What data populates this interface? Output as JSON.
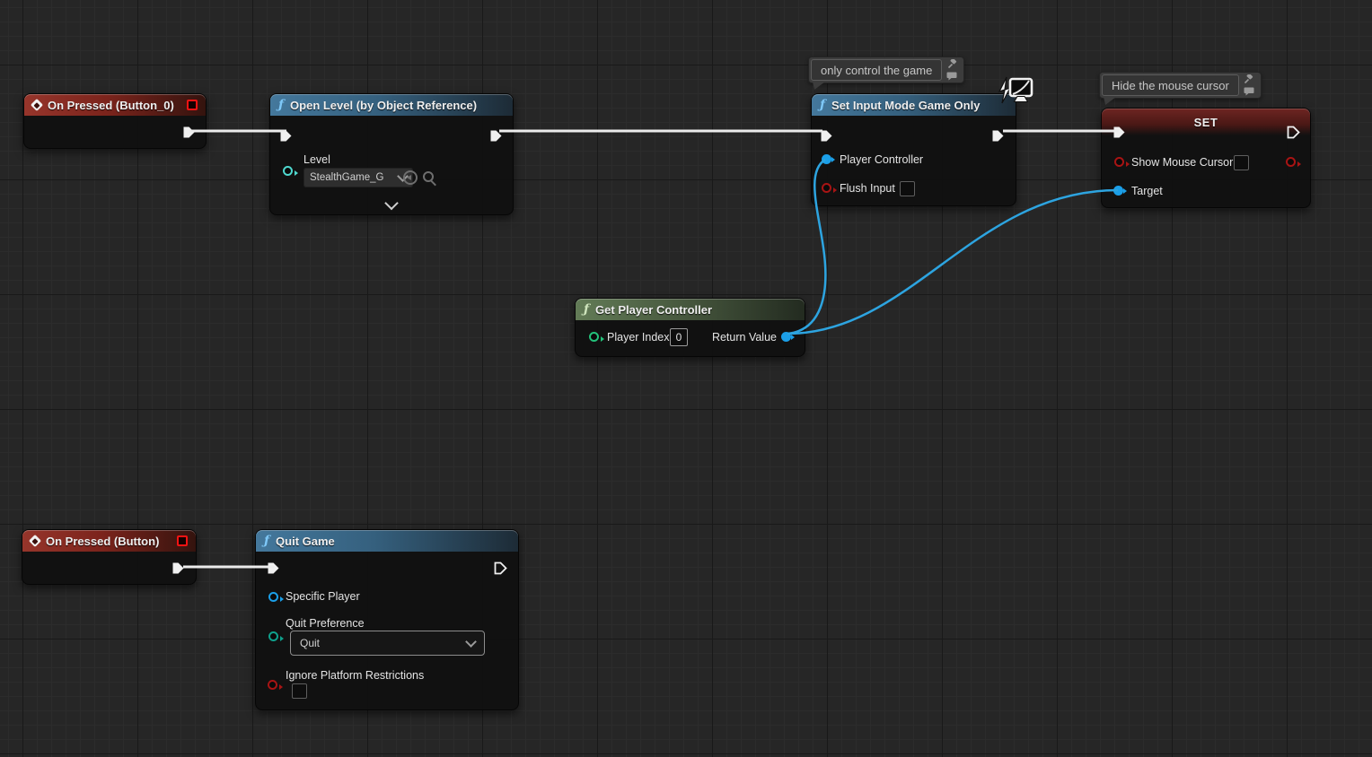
{
  "graph": {
    "comments": {
      "game_only": "only control the game",
      "hide_cursor": "Hide the mouse cursor"
    },
    "nodes": {
      "on_pressed_0": {
        "title": "On Pressed (Button_0)"
      },
      "open_level": {
        "title": "Open Level (by Object Reference)",
        "level_label": "Level",
        "level_value": "StealthGame_G"
      },
      "set_input_mode": {
        "title": "Set Input Mode Game Only",
        "player_controller_label": "Player Controller",
        "flush_input_label": "Flush Input"
      },
      "set_show_mouse": {
        "title": "SET",
        "show_mouse_cursor_label": "Show Mouse Cursor",
        "target_label": "Target"
      },
      "get_player_controller": {
        "title": "Get Player Controller",
        "player_index_label": "Player Index",
        "player_index_value": "0",
        "return_value_label": "Return Value"
      },
      "on_pressed": {
        "title": "On Pressed (Button)"
      },
      "quit_game": {
        "title": "Quit Game",
        "specific_player_label": "Specific Player",
        "quit_preference_label": "Quit Preference",
        "quit_preference_value": "Quit",
        "ignore_platform_label": "Ignore Platform Restrictions"
      }
    },
    "icons": {
      "function_glyph": "ƒ"
    },
    "colors": {
      "exec_wire": "#ececec",
      "data_wire_object": "#2da4e0",
      "pin_object": "#1b9fe8",
      "pin_bool": "#a81414",
      "pin_soft_object": "#4fd8cf",
      "pin_int": "#23c17a",
      "pin_enum": "#0fa08c",
      "header_function": "#44789c",
      "header_event": "#96352b",
      "header_pure": "#627b56",
      "header_set": "#6e2522"
    }
  }
}
